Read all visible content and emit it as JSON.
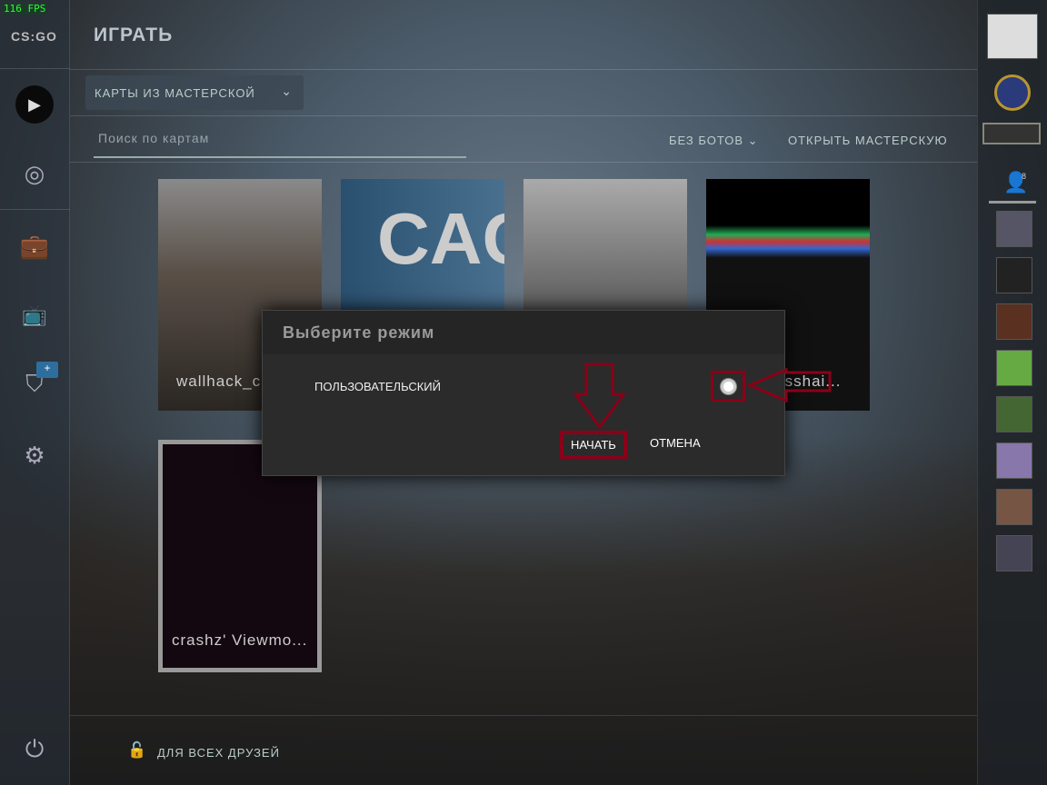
{
  "fps": "116 FPS",
  "logo": "CS:GO",
  "header": {
    "title": "ИГРАТЬ"
  },
  "mode_dropdown": {
    "value": "КАРТЫ ИЗ МАСТЕРСКОЙ"
  },
  "search": {
    "placeholder": "Поиск по картам"
  },
  "filters": {
    "bots": "БЕЗ БОТОВ",
    "open_workshop": "ОТКРЫТЬ МАСТЕРСКУЮ"
  },
  "maps": [
    {
      "label": "wallhack_c..."
    },
    {
      "label": ""
    },
    {
      "label": ""
    },
    {
      "label": "crosshai..."
    },
    {
      "label": "crashz' Viewmo..."
    }
  ],
  "modal": {
    "title": "Выберите режим",
    "option": "ПОЛЬЗОВАТЕЛЬСКИЙ",
    "start": "НАЧАТЬ",
    "cancel": "ОТМЕНА"
  },
  "footer": {
    "privacy": "ДЛЯ ВСЕХ ДРУЗЕЙ"
  },
  "friends": {
    "count": "8"
  },
  "badge": "+",
  "colors": {
    "highlight": "#8a0018",
    "fps": "#30ff30"
  }
}
